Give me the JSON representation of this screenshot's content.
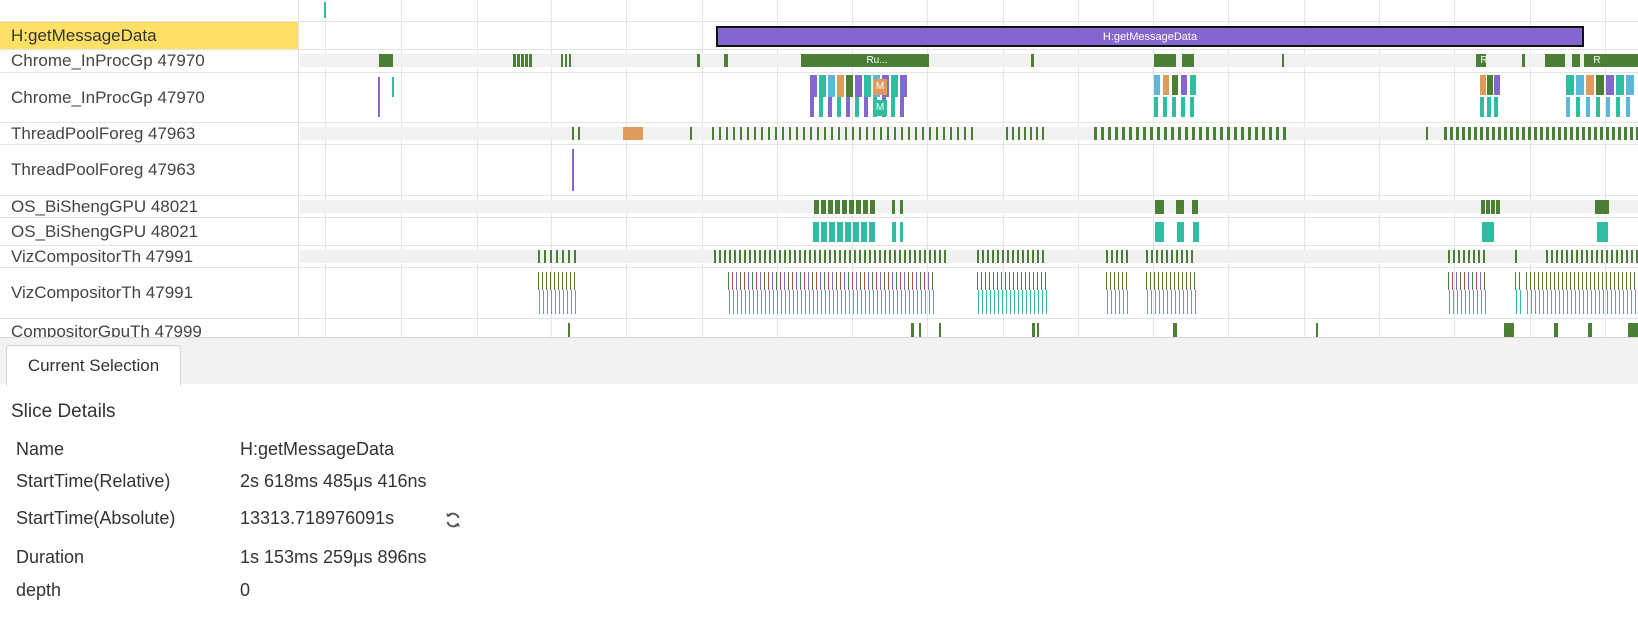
{
  "timeline": {
    "selected_slice_label": "H:getMessageData",
    "slice_labels": {
      "ru": "Ru...",
      "m1": "M",
      "m2": "M",
      "r1": "R",
      "r2": "R"
    },
    "rows": [
      {
        "label": "H:getMessageData",
        "highlighted": true
      },
      {
        "label": "Chrome_InProcGp 47970"
      },
      {
        "label": "Chrome_InProcGp 47970"
      },
      {
        "label": "ThreadPoolForeg 47963"
      },
      {
        "label": "ThreadPoolForeg 47963"
      },
      {
        "label": "OS_BiShengGPU 48021"
      },
      {
        "label": "OS_BiShengGPU 48021"
      },
      {
        "label": "VizCompositorTh 47991"
      },
      {
        "label": "VizCompositorTh 47991"
      },
      {
        "label": "CompositorGpuTh 47999"
      }
    ],
    "colors": {
      "highlight": "#ffe066",
      "slice_green": "#4a7f35",
      "slice_teal": "#2fbca0",
      "slice_purple": "#8466d0",
      "slice_orange": "#e09a5c",
      "slice_blue": "#5cb8d8"
    }
  },
  "panel": {
    "tab_label": "Current Selection",
    "section_title": "Slice Details",
    "details": [
      {
        "key": "Name",
        "value": "H:getMessageData"
      },
      {
        "key": "StartTime(Relative)",
        "value": "2s 618ms 485μs 416ns"
      },
      {
        "key": "StartTime(Absolute)",
        "value": "13313.718976091s",
        "icon": "refresh-icon"
      },
      {
        "key": "Duration",
        "value": "1s 153ms 259μs 896ns"
      },
      {
        "key": "depth",
        "value": "0"
      }
    ]
  }
}
